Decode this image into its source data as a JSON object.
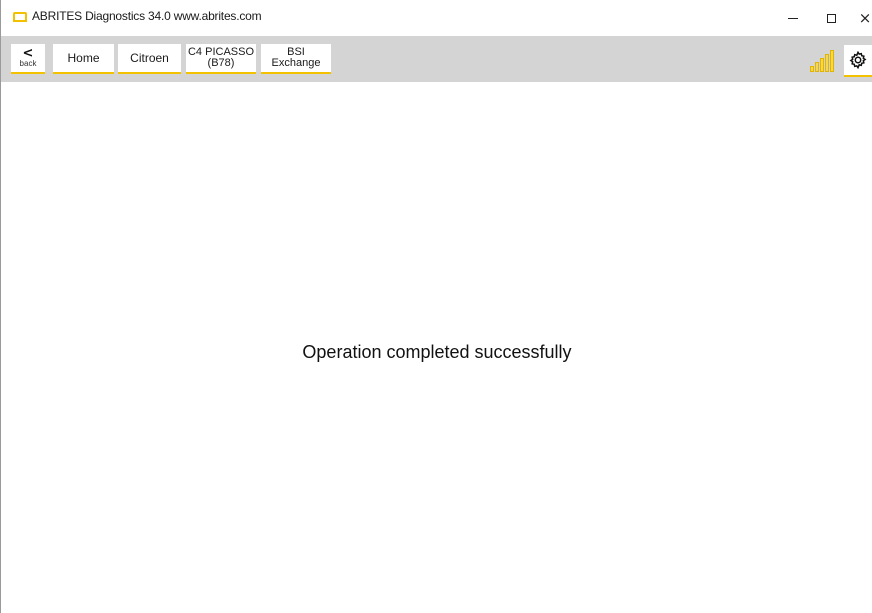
{
  "window": {
    "title": "ABRITES Diagnostics 34.0   www.abrites.com",
    "accent_color": "#f2c200",
    "controls": {
      "minimize_icon": "minimize-icon",
      "maximize_icon": "maximize-icon",
      "close_icon": "close-icon",
      "close_glyph": "×"
    }
  },
  "toolbar": {
    "back": {
      "arrow": "<",
      "label": "back"
    },
    "breadcrumbs": [
      {
        "line1": "Home",
        "line2": ""
      },
      {
        "line1": "Citroen",
        "line2": ""
      },
      {
        "line1": "C4 PICASSO",
        "line2": "(B78)"
      },
      {
        "line1": "BSI",
        "line2": "Exchange"
      }
    ],
    "signal_icon": "signal-strength-icon",
    "settings_icon": "gear-icon"
  },
  "main": {
    "status_message": "Operation completed successfully"
  }
}
